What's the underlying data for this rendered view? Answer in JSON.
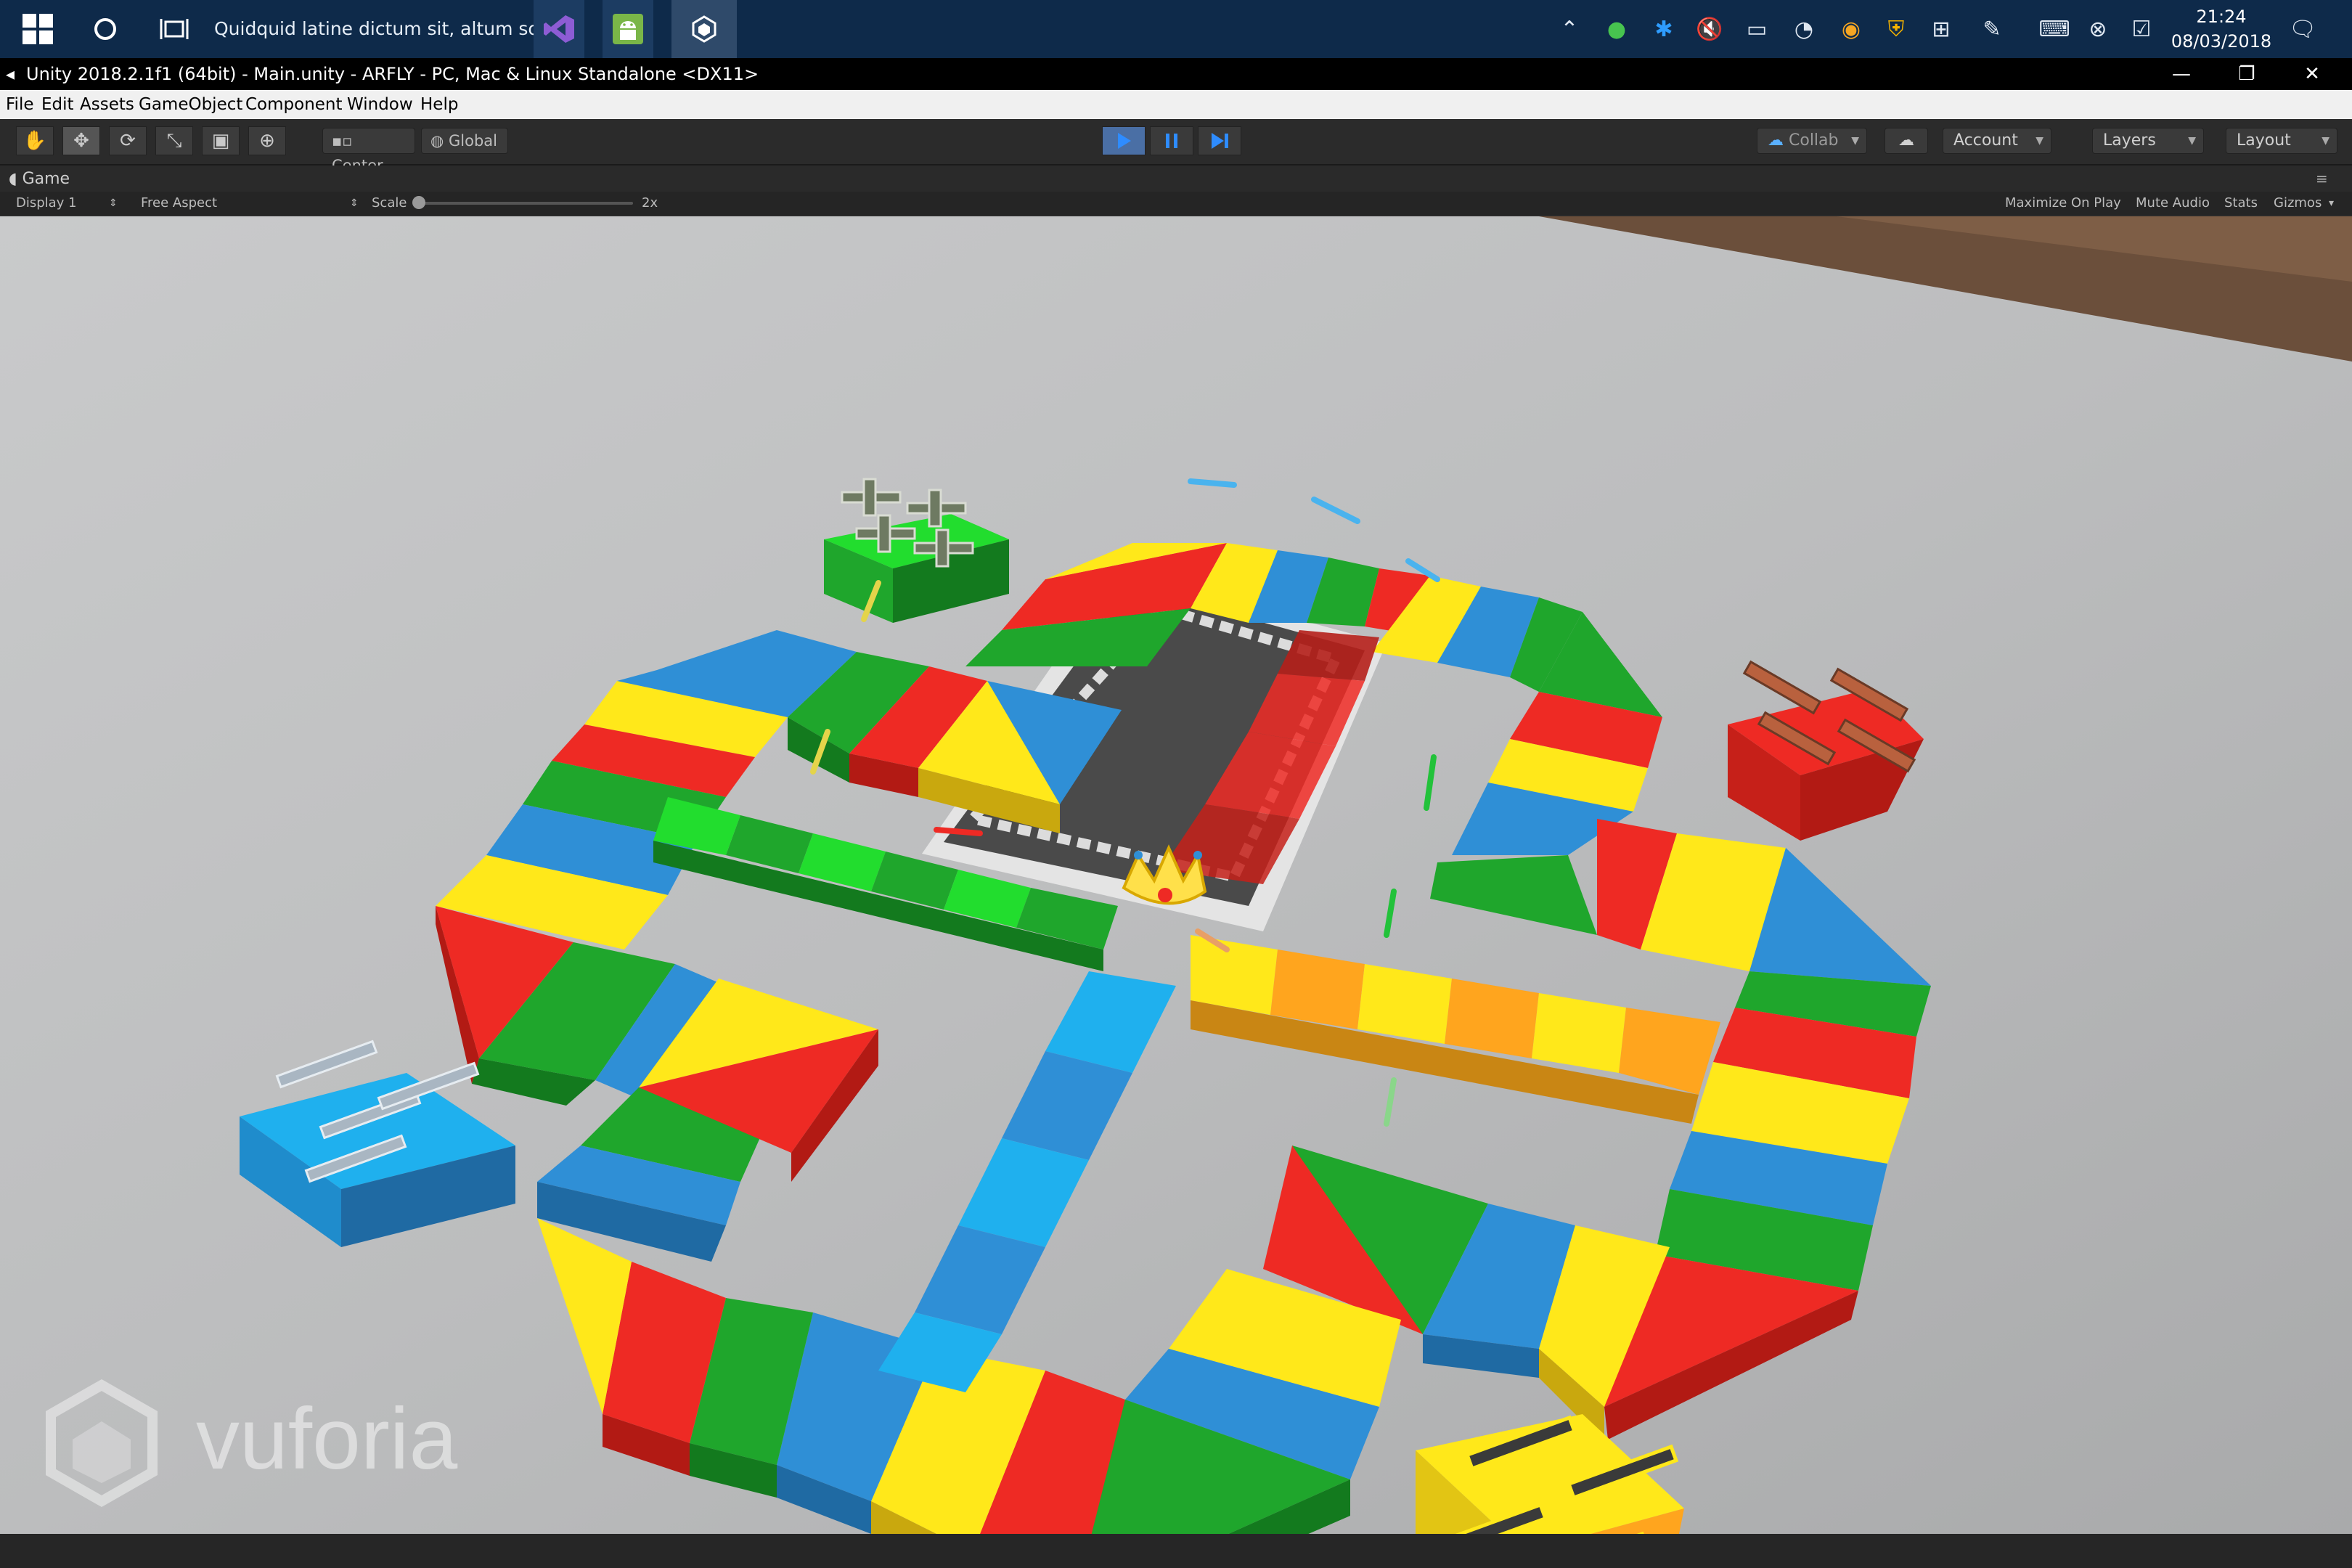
{
  "taskbar": {
    "search_text": "Quidquid latine dictum sit, altum sonat",
    "time": "21:24",
    "date": "08/03/2018"
  },
  "window": {
    "title": "Unity 2018.2.1f1 (64bit) - Main.unity - ARFLY - PC, Mac & Linux Standalone <DX11>"
  },
  "menu": [
    "File",
    "Edit",
    "Assets",
    "GameObject",
    "Component",
    "Window",
    "Help"
  ],
  "toolbar": {
    "pivot_label": "Center",
    "space_label": "Global",
    "collab_label": "Collab",
    "account_label": "Account",
    "layers_label": "Layers",
    "layout_label": "Layout"
  },
  "game_view": {
    "tab_label": "Game",
    "display_label": "Display 1",
    "aspect_label": "Free Aspect",
    "scale_label": "Scale",
    "scale_value": "2x",
    "maximize_label": "Maximize On Play",
    "mute_label": "Mute Audio",
    "stats_label": "Stats",
    "gizmos_label": "Gizmos",
    "watermark": "vuforia"
  },
  "colors": {
    "red": "#ee2a24",
    "yellow": "#ffe81a",
    "green": "#1fa62c",
    "blue": "#2f8fd6",
    "light_blue": "#1fb0ee",
    "orange": "#ffa51e",
    "light_green": "#22dd2e"
  }
}
